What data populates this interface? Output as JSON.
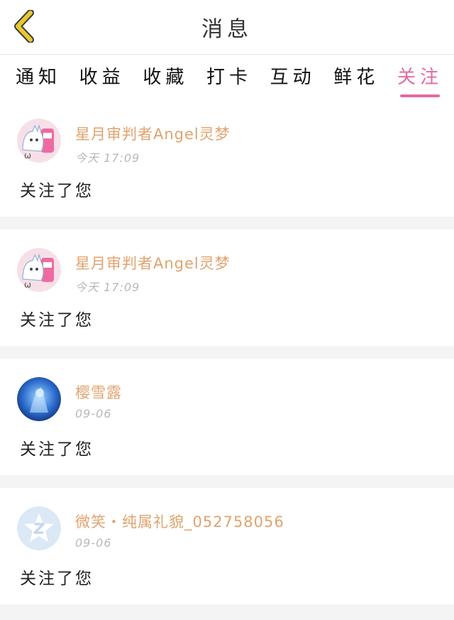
{
  "header": {
    "title": "消息",
    "back_icon": "chevron-left-icon",
    "back_color": "#e8c82e"
  },
  "tabs": [
    {
      "label": "通知",
      "active": false
    },
    {
      "label": "收益",
      "active": false
    },
    {
      "label": "收藏",
      "active": false
    },
    {
      "label": "打卡",
      "active": false
    },
    {
      "label": "互动",
      "active": false
    },
    {
      "label": "鲜花",
      "active": false
    },
    {
      "label": "关注",
      "active": true
    }
  ],
  "accent_color": "#e16aa4",
  "username_color": "#e0a36e",
  "messages": [
    {
      "username": "星月审判者Angel灵梦",
      "time": "今天 17:09",
      "text": "关注了您",
      "avatar": "cat-avatar-icon"
    },
    {
      "username": "星月审判者Angel灵梦",
      "time": "今天 17:09",
      "text": "关注了您",
      "avatar": "cat-avatar-icon"
    },
    {
      "username": "樱雪露",
      "time": "09-06",
      "text": "关注了您",
      "avatar": "blue-art-avatar-icon"
    },
    {
      "username": "微笑・纯属礼貌_052758056",
      "time": "09-06",
      "text": "关注了您",
      "avatar": "default-z-avatar-icon"
    }
  ]
}
